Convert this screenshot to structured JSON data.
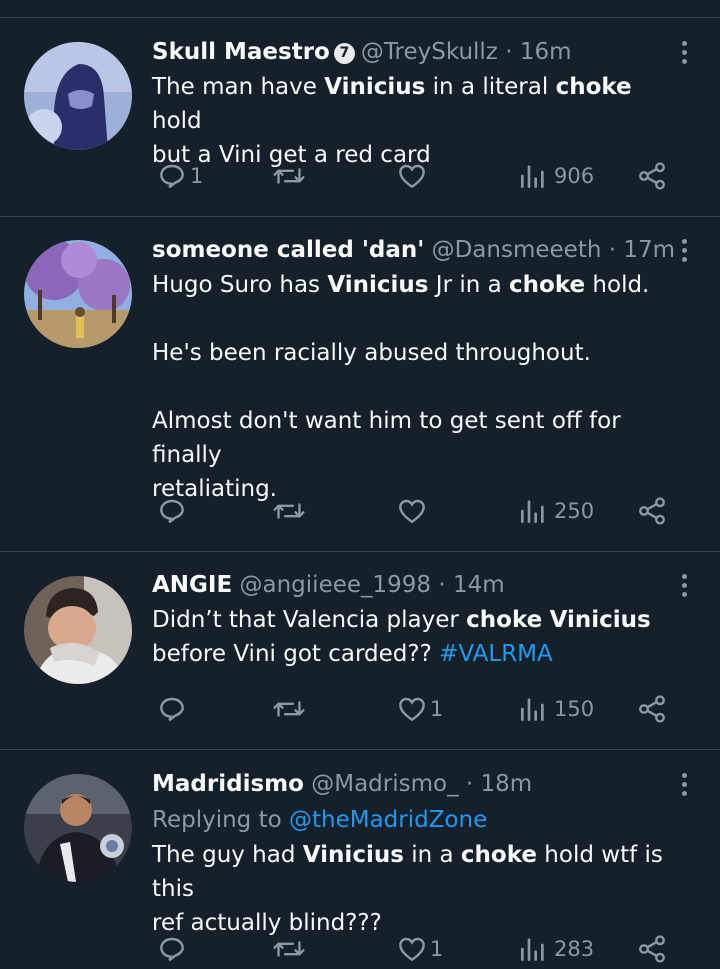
{
  "tweets": [
    {
      "name": "Skull Maestro",
      "badge": "7",
      "handle": "@TreySkullz",
      "time": "· 16m",
      "lines": [
        [
          {
            "t": "The man have "
          },
          {
            "t": "Vinicius",
            "b": true
          },
          {
            "t": " in a literal "
          },
          {
            "t": "choke",
            "b": true
          },
          {
            "t": " hold"
          }
        ],
        [
          {
            "t": "but a Vini get a red card"
          }
        ]
      ],
      "replies": "1",
      "retweets": "",
      "likes": "",
      "views": "906"
    },
    {
      "name": "someone called 'dan'",
      "handle": "@Dansmeeeth",
      "time": "· 17m",
      "lines": [
        [
          {
            "t": "Hugo Suro has "
          },
          {
            "t": "Vinicius",
            "b": true
          },
          {
            "t": " Jr in a "
          },
          {
            "t": "choke",
            "b": true
          },
          {
            "t": " hold."
          }
        ],
        [],
        [
          {
            "t": "He's been racially abused throughout."
          }
        ],
        [],
        [
          {
            "t": "Almost don't want him to get sent off for finally"
          }
        ],
        [
          {
            "t": "retaliating."
          }
        ]
      ],
      "replies": "",
      "retweets": "",
      "likes": "",
      "views": "250"
    },
    {
      "name": "ANGIE",
      "handle": "@angiieee_1998",
      "time": "· 14m",
      "lines": [
        [
          {
            "t": "Didn’t that Valencia player "
          },
          {
            "t": "choke",
            "b": true
          },
          {
            "t": " "
          },
          {
            "t": "Vinicius",
            "b": true
          }
        ],
        [
          {
            "t": "before Vini got carded?? "
          },
          {
            "t": "#VALRMA",
            "link": true
          }
        ]
      ],
      "replies": "",
      "retweets": "",
      "likes": "1",
      "views": "150"
    },
    {
      "name": "Madridismo",
      "handle": "@Madrismo_",
      "time": "· 18m",
      "replying_prefix": "Replying to ",
      "replying_to": "@theMadridZone",
      "lines": [
        [
          {
            "t": "The guy had "
          },
          {
            "t": "Vinicius",
            "b": true
          },
          {
            "t": " in a "
          },
          {
            "t": "choke",
            "b": true
          },
          {
            "t": " hold wtf is this"
          }
        ],
        [
          {
            "t": "ref actually blind???"
          }
        ]
      ],
      "replies": "",
      "retweets": "",
      "likes": "1",
      "views": "283"
    }
  ],
  "colors": {
    "background": "#15202b",
    "text": "#f7f9f9",
    "muted": "#8b98a5",
    "link": "#1d9bf0",
    "divider": "#38444d"
  },
  "icons": [
    "reply-icon",
    "retweet-icon",
    "like-icon",
    "views-icon",
    "share-icon",
    "more-icon",
    "verified-badge"
  ]
}
